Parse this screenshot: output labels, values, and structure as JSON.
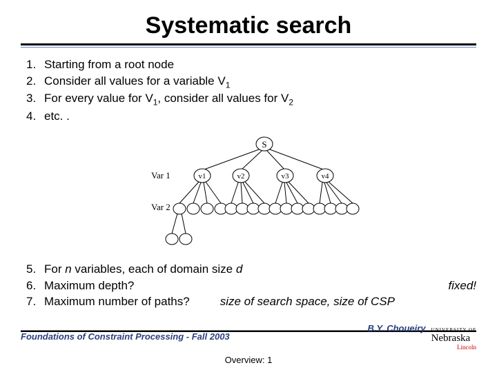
{
  "title": "Systematic search",
  "items_top": [
    {
      "n": "1.",
      "text": "Starting from a root node"
    },
    {
      "n": "2.",
      "text_html": "Consider all values for a variable V<sub>1</sub>"
    },
    {
      "n": "3.",
      "text_html": "For every value for V<sub>1</sub>, consider all values for V<sub>2</sub>"
    },
    {
      "n": "4.",
      "text": "etc. ."
    }
  ],
  "diagram": {
    "root_label": "S",
    "var1_label": "Var 1",
    "var2_label": "Var 2",
    "level1_nodes": [
      "v1",
      "v2",
      "v3",
      "v4"
    ]
  },
  "items_bottom": {
    "r5": {
      "n": "5.",
      "text_html": "For <i>n</i> variables, each of  domain size <i>d</i>"
    },
    "r6": {
      "n": "6.",
      "text": "Maximum depth?",
      "ans": "fixed!"
    },
    "r7": {
      "n": "7.",
      "text": "Maximum number of paths?",
      "ans": "size of search space, size of CSP"
    }
  },
  "footer": {
    "left": "Foundations of Constraint Processing - Fall 2003",
    "author": "B.Y. Choueiry",
    "university": "Nebraska",
    "univ_top": "UNIVERSITY OF",
    "univ_bottom": "Lincoln"
  },
  "overview": "Overview: 1"
}
